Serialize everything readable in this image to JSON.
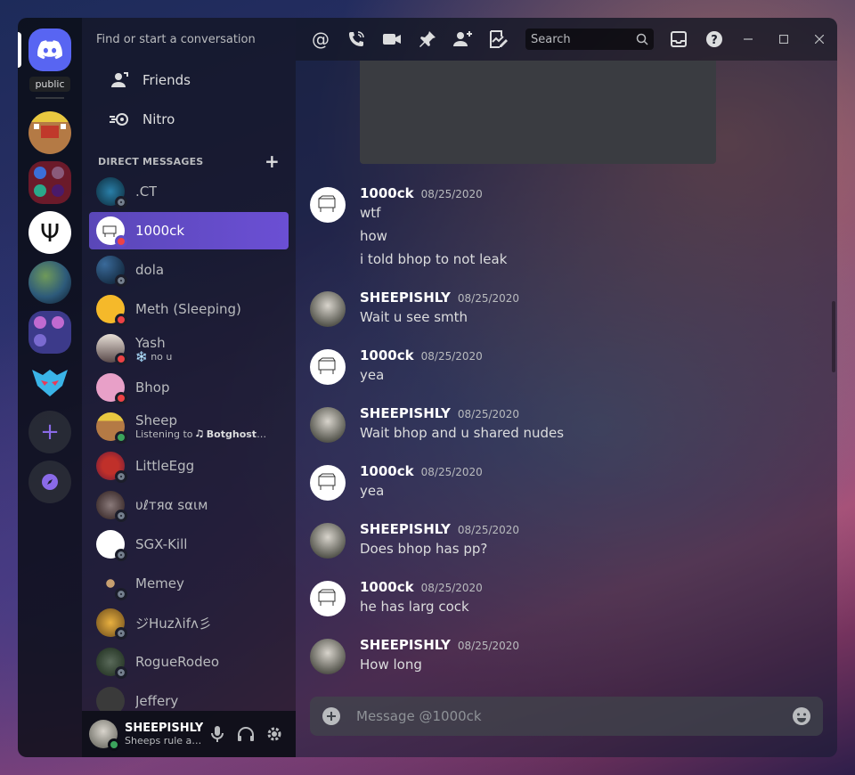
{
  "rail": {
    "public_label": "public"
  },
  "sidebar": {
    "search_placeholder": "Find or start a conversation",
    "nav": [
      {
        "label": "Friends"
      },
      {
        "label": "Nitro"
      }
    ],
    "dm_header": "DIRECT MESSAGES",
    "dms": [
      {
        "name": ".CT",
        "sub": "",
        "status": "offline"
      },
      {
        "name": "1000ck",
        "sub": "",
        "status": "dnd",
        "active": true
      },
      {
        "name": "dola",
        "sub": "",
        "status": "offline"
      },
      {
        "name": "Meth (Sleeping)",
        "sub": "",
        "status": "dnd"
      },
      {
        "name": "Yash",
        "sub": "❄️ no u",
        "status": "dnd"
      },
      {
        "name": "Bhop",
        "sub": "",
        "status": "dnd"
      },
      {
        "name": "Sheep",
        "sub_prefix": "Listening to ",
        "sub_bold": "🎝 Botghost.co...",
        "status": "online"
      },
      {
        "name": "LittleEgg",
        "sub": "",
        "status": "offline"
      },
      {
        "name": "υℓтяα ѕαιм",
        "sub": "",
        "status": "offline"
      },
      {
        "name": "SGX-Kill",
        "sub": "",
        "status": "offline"
      },
      {
        "name": "Memey",
        "sub": "",
        "status": "offline"
      },
      {
        "name": "ジHuzλifᴧ彡",
        "sub": "",
        "status": "offline"
      },
      {
        "name": "RogueRodeo",
        "sub": "",
        "status": "offline"
      },
      {
        "name": "Jeffery",
        "sub": "",
        "status": "offline"
      }
    ],
    "user": {
      "name": "SHEEPISHLY",
      "status": "Sheeps rule an..."
    }
  },
  "topbar": {
    "search_placeholder": "Search"
  },
  "messages": [
    {
      "author": "1000ck",
      "time": "08/25/2020",
      "lines": [
        "wtf",
        "how",
        "i told bhop to not leak"
      ],
      "avatar": "1000ck"
    },
    {
      "author": "SHEEPISHLY",
      "time": "08/25/2020",
      "lines": [
        "Wait u see smth"
      ],
      "avatar": "sheep"
    },
    {
      "author": "1000ck",
      "time": "08/25/2020",
      "lines": [
        "yea"
      ],
      "avatar": "1000ck"
    },
    {
      "author": "SHEEPISHLY",
      "time": "08/25/2020",
      "lines": [
        "Wait bhop and u shared nudes"
      ],
      "avatar": "sheep"
    },
    {
      "author": "1000ck",
      "time": "08/25/2020",
      "lines": [
        "yea"
      ],
      "avatar": "1000ck"
    },
    {
      "author": "SHEEPISHLY",
      "time": "08/25/2020",
      "lines": [
        "Does bhop has pp?"
      ],
      "avatar": "sheep"
    },
    {
      "author": "1000ck",
      "time": "08/25/2020",
      "lines": [
        "he has larg cock"
      ],
      "avatar": "1000ck"
    },
    {
      "author": "SHEEPISHLY",
      "time": "08/25/2020",
      "lines": [
        "How long"
      ],
      "avatar": "sheep"
    }
  ],
  "composer": {
    "placeholder": "Message @1000ck"
  },
  "colors": {
    "accent": "#5865f2",
    "active_dm": "#6b4fd4",
    "dnd": "#ed4245",
    "online": "#3ba55c",
    "offline": "#747f8d"
  }
}
